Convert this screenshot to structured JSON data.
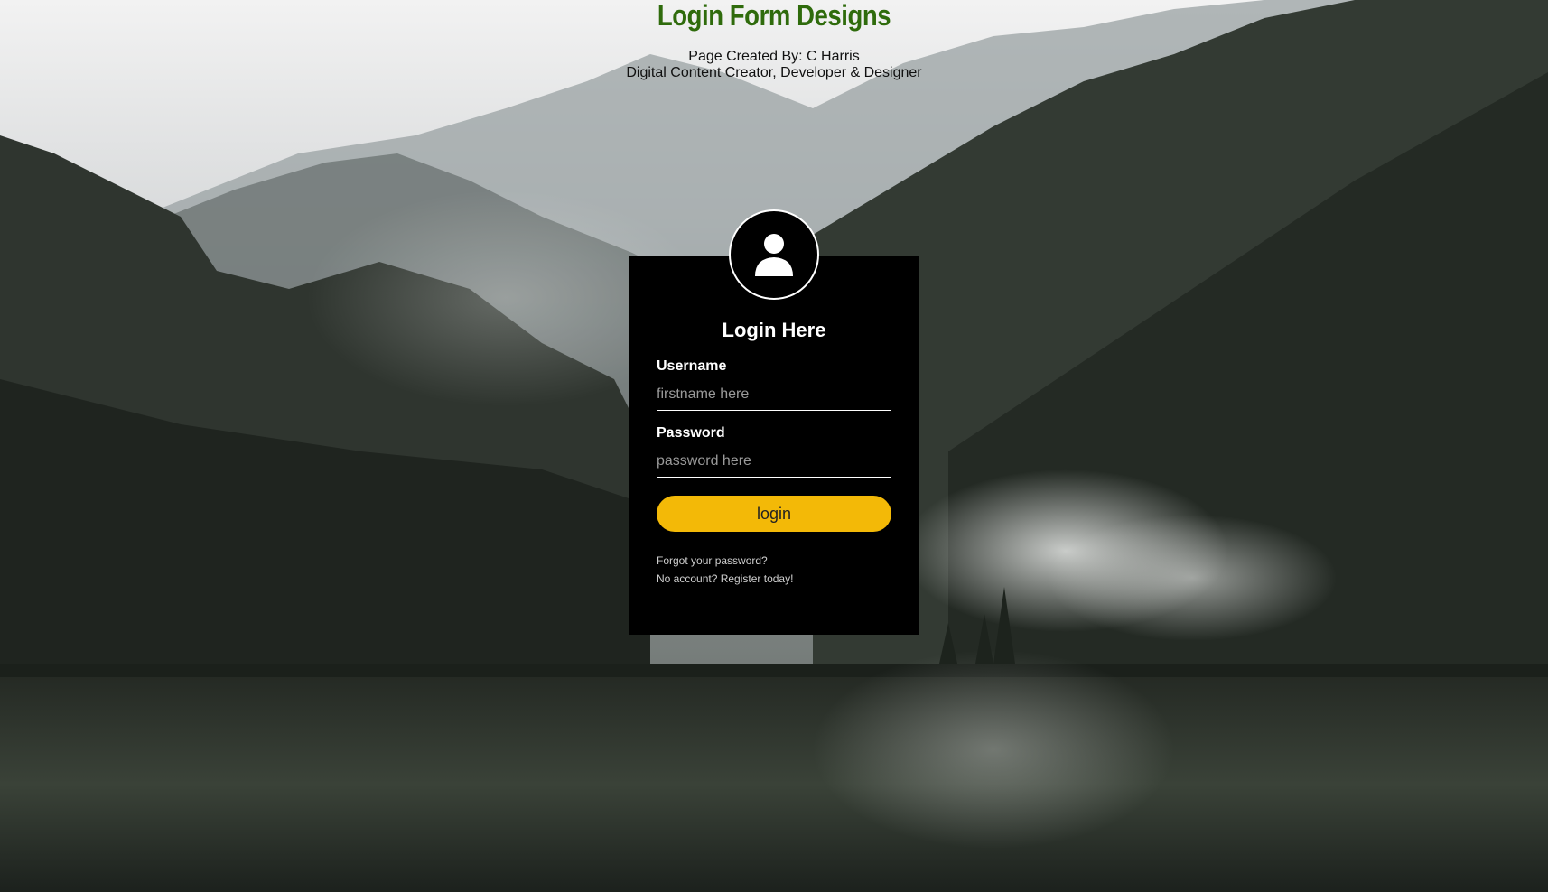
{
  "page": {
    "title": "Login Form Designs",
    "credit_line": "Page Created By: C Harris",
    "credit_role": "Digital Content Creator, Developer & Designer"
  },
  "login": {
    "heading": "Login Here",
    "avatar_icon": "user-icon",
    "username_label": "Username",
    "username_placeholder": "firstname here",
    "username_value": "",
    "password_label": "Password",
    "password_placeholder": "password here",
    "password_value": "",
    "button_label": "login",
    "forgot_link": "Forgot your password?",
    "register_link": "No account? Register today!"
  },
  "colors": {
    "title": "#2f6b0c",
    "form_background": "#000000",
    "button": "#f3b907",
    "input_border": "#ffffff"
  }
}
